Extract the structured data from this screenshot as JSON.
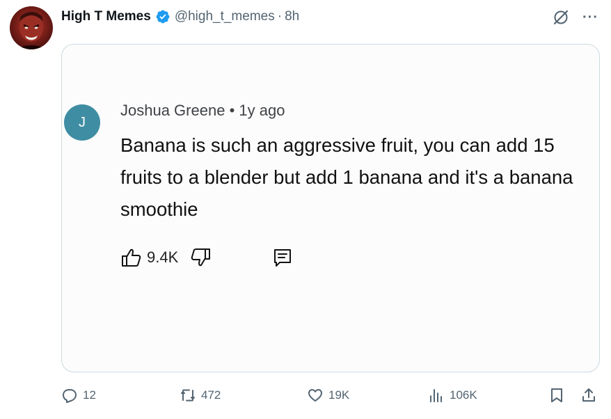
{
  "post": {
    "display_name": "High T Memes",
    "handle": "@high_t_memes",
    "separator": "·",
    "time": "8h",
    "verified_color": "#1d9bf0",
    "more_label": "···"
  },
  "comment": {
    "avatar_letter": "J",
    "avatar_color": "#3f8da3",
    "author": "Joshua Greene",
    "separator": "•",
    "time": "1y ago",
    "text": "Banana is such an aggressive fruit, you can add 15 fruits to a blender but add 1 banana and it's a banana smoothie",
    "like_count": "9.4K"
  },
  "engagement": {
    "replies": "12",
    "reposts": "472",
    "likes": "19K",
    "views": "106K"
  },
  "icons": {
    "avatar": "profile-photo",
    "verified": "verified-badge-icon",
    "grok": "grok-icon",
    "more": "more-icon",
    "thumbs_up": "thumbs-up-icon",
    "thumbs_down": "thumbs-down-icon",
    "comment_reply": "comment-icon",
    "reply": "reply-icon",
    "repost": "repost-icon",
    "like": "heart-icon",
    "views": "views-icon",
    "bookmark": "bookmark-icon",
    "share": "share-icon"
  }
}
